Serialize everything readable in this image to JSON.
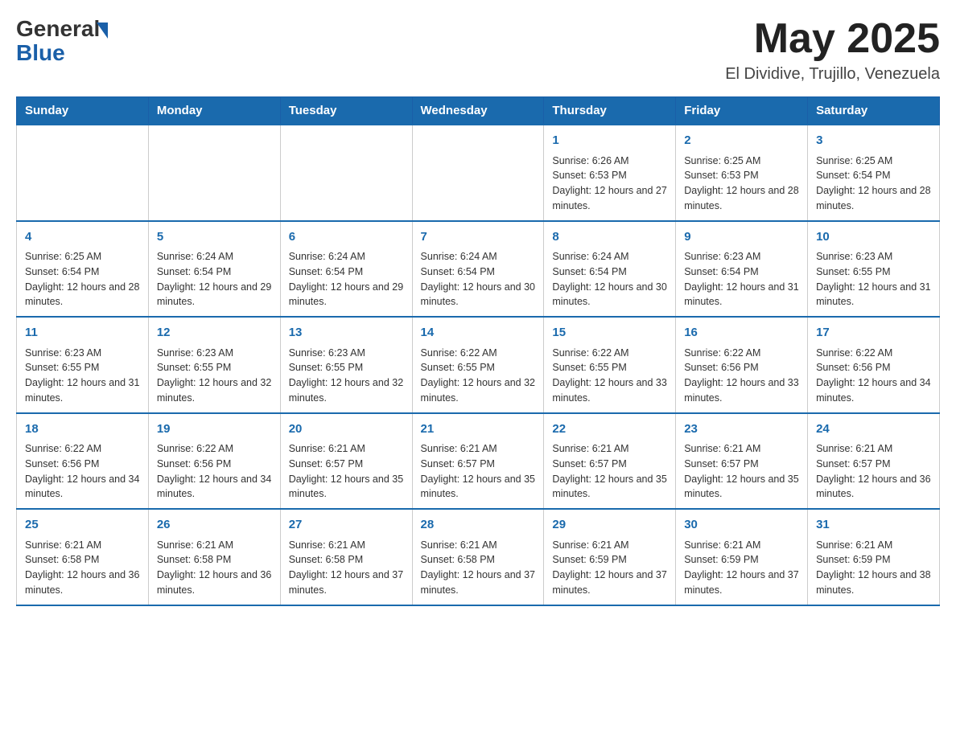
{
  "header": {
    "month_title": "May 2025",
    "location": "El Dividive, Trujillo, Venezuela"
  },
  "days_of_week": [
    "Sunday",
    "Monday",
    "Tuesday",
    "Wednesday",
    "Thursday",
    "Friday",
    "Saturday"
  ],
  "weeks": [
    {
      "days": [
        {
          "number": "",
          "info": ""
        },
        {
          "number": "",
          "info": ""
        },
        {
          "number": "",
          "info": ""
        },
        {
          "number": "",
          "info": ""
        },
        {
          "number": "1",
          "info": "Sunrise: 6:26 AM\nSunset: 6:53 PM\nDaylight: 12 hours and 27 minutes."
        },
        {
          "number": "2",
          "info": "Sunrise: 6:25 AM\nSunset: 6:53 PM\nDaylight: 12 hours and 28 minutes."
        },
        {
          "number": "3",
          "info": "Sunrise: 6:25 AM\nSunset: 6:54 PM\nDaylight: 12 hours and 28 minutes."
        }
      ]
    },
    {
      "days": [
        {
          "number": "4",
          "info": "Sunrise: 6:25 AM\nSunset: 6:54 PM\nDaylight: 12 hours and 28 minutes."
        },
        {
          "number": "5",
          "info": "Sunrise: 6:24 AM\nSunset: 6:54 PM\nDaylight: 12 hours and 29 minutes."
        },
        {
          "number": "6",
          "info": "Sunrise: 6:24 AM\nSunset: 6:54 PM\nDaylight: 12 hours and 29 minutes."
        },
        {
          "number": "7",
          "info": "Sunrise: 6:24 AM\nSunset: 6:54 PM\nDaylight: 12 hours and 30 minutes."
        },
        {
          "number": "8",
          "info": "Sunrise: 6:24 AM\nSunset: 6:54 PM\nDaylight: 12 hours and 30 minutes."
        },
        {
          "number": "9",
          "info": "Sunrise: 6:23 AM\nSunset: 6:54 PM\nDaylight: 12 hours and 31 minutes."
        },
        {
          "number": "10",
          "info": "Sunrise: 6:23 AM\nSunset: 6:55 PM\nDaylight: 12 hours and 31 minutes."
        }
      ]
    },
    {
      "days": [
        {
          "number": "11",
          "info": "Sunrise: 6:23 AM\nSunset: 6:55 PM\nDaylight: 12 hours and 31 minutes."
        },
        {
          "number": "12",
          "info": "Sunrise: 6:23 AM\nSunset: 6:55 PM\nDaylight: 12 hours and 32 minutes."
        },
        {
          "number": "13",
          "info": "Sunrise: 6:23 AM\nSunset: 6:55 PM\nDaylight: 12 hours and 32 minutes."
        },
        {
          "number": "14",
          "info": "Sunrise: 6:22 AM\nSunset: 6:55 PM\nDaylight: 12 hours and 32 minutes."
        },
        {
          "number": "15",
          "info": "Sunrise: 6:22 AM\nSunset: 6:55 PM\nDaylight: 12 hours and 33 minutes."
        },
        {
          "number": "16",
          "info": "Sunrise: 6:22 AM\nSunset: 6:56 PM\nDaylight: 12 hours and 33 minutes."
        },
        {
          "number": "17",
          "info": "Sunrise: 6:22 AM\nSunset: 6:56 PM\nDaylight: 12 hours and 34 minutes."
        }
      ]
    },
    {
      "days": [
        {
          "number": "18",
          "info": "Sunrise: 6:22 AM\nSunset: 6:56 PM\nDaylight: 12 hours and 34 minutes."
        },
        {
          "number": "19",
          "info": "Sunrise: 6:22 AM\nSunset: 6:56 PM\nDaylight: 12 hours and 34 minutes."
        },
        {
          "number": "20",
          "info": "Sunrise: 6:21 AM\nSunset: 6:57 PM\nDaylight: 12 hours and 35 minutes."
        },
        {
          "number": "21",
          "info": "Sunrise: 6:21 AM\nSunset: 6:57 PM\nDaylight: 12 hours and 35 minutes."
        },
        {
          "number": "22",
          "info": "Sunrise: 6:21 AM\nSunset: 6:57 PM\nDaylight: 12 hours and 35 minutes."
        },
        {
          "number": "23",
          "info": "Sunrise: 6:21 AM\nSunset: 6:57 PM\nDaylight: 12 hours and 35 minutes."
        },
        {
          "number": "24",
          "info": "Sunrise: 6:21 AM\nSunset: 6:57 PM\nDaylight: 12 hours and 36 minutes."
        }
      ]
    },
    {
      "days": [
        {
          "number": "25",
          "info": "Sunrise: 6:21 AM\nSunset: 6:58 PM\nDaylight: 12 hours and 36 minutes."
        },
        {
          "number": "26",
          "info": "Sunrise: 6:21 AM\nSunset: 6:58 PM\nDaylight: 12 hours and 36 minutes."
        },
        {
          "number": "27",
          "info": "Sunrise: 6:21 AM\nSunset: 6:58 PM\nDaylight: 12 hours and 37 minutes."
        },
        {
          "number": "28",
          "info": "Sunrise: 6:21 AM\nSunset: 6:58 PM\nDaylight: 12 hours and 37 minutes."
        },
        {
          "number": "29",
          "info": "Sunrise: 6:21 AM\nSunset: 6:59 PM\nDaylight: 12 hours and 37 minutes."
        },
        {
          "number": "30",
          "info": "Sunrise: 6:21 AM\nSunset: 6:59 PM\nDaylight: 12 hours and 37 minutes."
        },
        {
          "number": "31",
          "info": "Sunrise: 6:21 AM\nSunset: 6:59 PM\nDaylight: 12 hours and 38 minutes."
        }
      ]
    }
  ]
}
